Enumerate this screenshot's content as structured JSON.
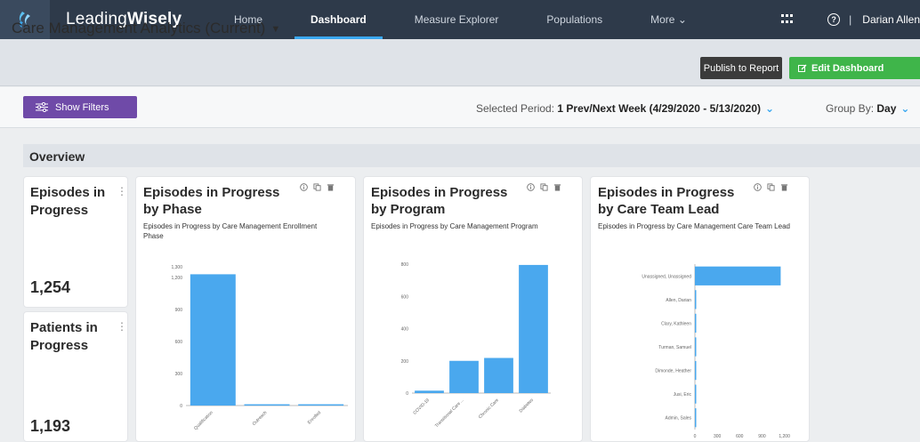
{
  "nav": {
    "brand_light": "Leading",
    "brand_bold": "Wisely",
    "items": [
      {
        "label": "Home"
      },
      {
        "label": "Dashboard"
      },
      {
        "label": "Measure Explorer"
      },
      {
        "label": "Populations"
      },
      {
        "label": "More ⌄"
      }
    ],
    "user": "Darian Allen"
  },
  "header": {
    "title": "Care Management Analytics (Current)",
    "publish_label": "Publish to Report",
    "edit_label": "Edit Dashboard"
  },
  "filters": {
    "show_filters_label": "Show Filters",
    "period_prefix": "Selected Period:",
    "period_value": "1 Prev/Next Week (4/29/2020 - 5/13/2020)",
    "groupby_prefix": "Group By:",
    "groupby_value": "Day"
  },
  "section": {
    "title": "Overview"
  },
  "kpis": [
    {
      "title_l1": "Episodes in",
      "title_l2": "Progress",
      "value": "1,254"
    },
    {
      "title_l1": "Patients in",
      "title_l2": "Progress",
      "value": "1,193"
    }
  ],
  "colors": {
    "bar": "#4aa8ee",
    "nav_bg": "#2e3a4a",
    "edit_btn": "#3fb54a",
    "filters_btn": "#6f4aa8"
  },
  "chart_data": [
    {
      "type": "bar",
      "title_l1": "Episodes in Progress",
      "title_l2": "by Phase",
      "subtitle": "Episodes in Progress by Care Management Enrollment Phase",
      "categories": [
        "Qualification",
        "Outreach",
        "Enrolled"
      ],
      "values": [
        1230,
        12,
        12
      ],
      "y_ticks": [
        "1,300",
        "1,200",
        "900",
        "600",
        "300",
        "0"
      ],
      "y_tick_values": [
        1300,
        1200,
        900,
        600,
        300,
        0
      ],
      "ylim": [
        0,
        1300
      ]
    },
    {
      "type": "bar",
      "title_l1": "Episodes in Progress",
      "title_l2": "by Program",
      "subtitle": "Episodes in Progress by Care Management Program",
      "categories": [
        "COVID-19",
        "Transitional Care ...",
        "Chronic Care",
        "Diabetes"
      ],
      "values": [
        15,
        200,
        218,
        795
      ],
      "y_ticks": [
        "800",
        "600",
        "400",
        "200",
        "0"
      ],
      "y_tick_values": [
        800,
        600,
        400,
        200,
        0
      ],
      "ylim": [
        0,
        800
      ]
    },
    {
      "type": "bar",
      "orientation": "horizontal",
      "title_l1": "Episodes in Progress",
      "title_l2": "by Care Team Lead",
      "subtitle": "Episodes in Progress by Care Management Care Team Lead",
      "categories": [
        "Unassigned, Unassigned",
        "Allen, Darian",
        "Clary, Kathleen",
        "Turman, Samuel",
        "Dimonde, Heather",
        "Jusi, Eric",
        "Admin, Sales"
      ],
      "values": [
        1150,
        3,
        3,
        3,
        3,
        3,
        3
      ],
      "x_ticks": [
        "0",
        "300",
        "600",
        "900",
        "1,200"
      ],
      "x_tick_values": [
        0,
        300,
        600,
        900,
        1200
      ],
      "xlim": [
        0,
        1300
      ]
    }
  ]
}
